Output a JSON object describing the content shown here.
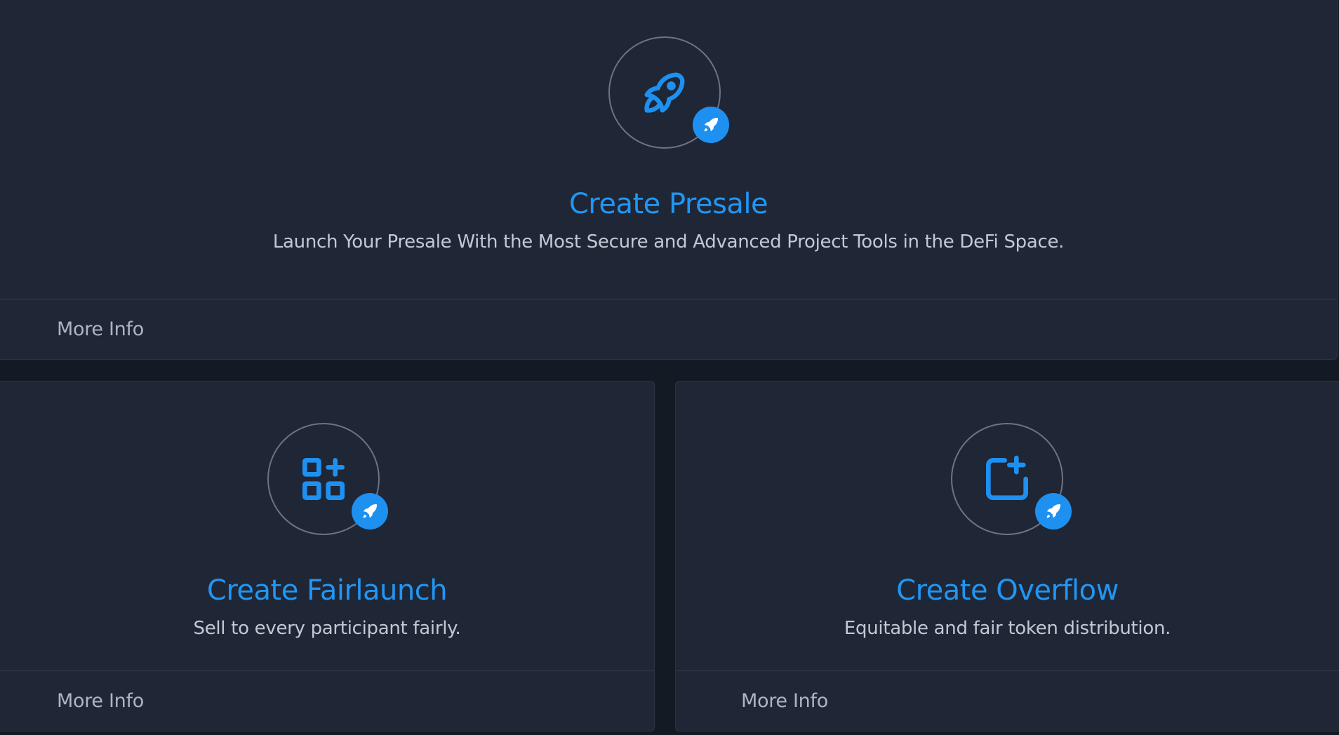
{
  "cards": [
    {
      "title": "Create Presale",
      "description": "Launch Your Presale With the Most Secure and Advanced Project Tools in the DeFi Space.",
      "footer_label": "More Info",
      "icon": "rocket-icon",
      "badge_icon": "rocket-badge-icon"
    },
    {
      "title": "Create Fairlaunch",
      "description": "Sell to every participant fairly.",
      "footer_label": "More Info",
      "icon": "apps-add-icon",
      "badge_icon": "rocket-badge-icon"
    },
    {
      "title": "Create Overflow",
      "description": "Equitable and fair token distribution.",
      "footer_label": "More Info",
      "icon": "square-plus-icon",
      "badge_icon": "rocket-badge-icon"
    }
  ],
  "colors": {
    "accent": "#2196f3",
    "badge": "#1e90f0",
    "card_bg": "#1f2636",
    "page_bg": "#141a24",
    "description": "#c3c8d3",
    "footer_text": "#aeb4c0"
  }
}
